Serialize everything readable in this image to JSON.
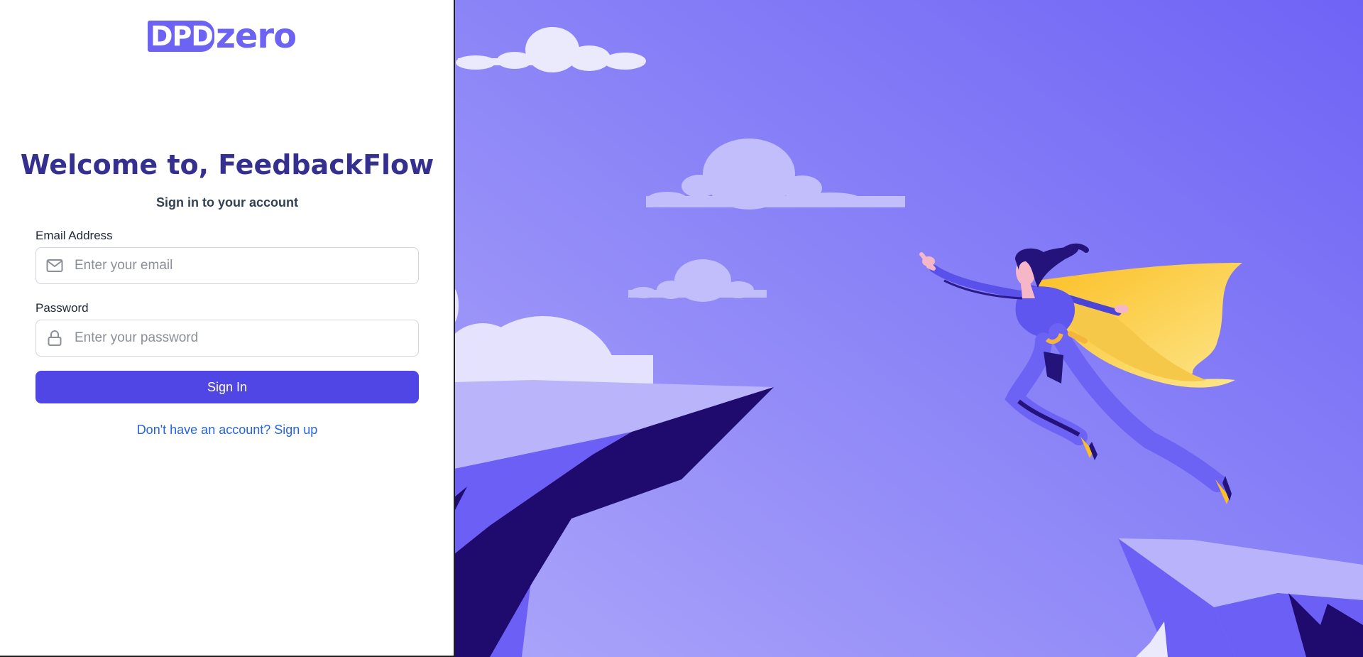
{
  "brand": {
    "logo_box": "DPD",
    "logo_rest": "zero"
  },
  "login": {
    "title": "Welcome to, FeedbackFlow",
    "subtitle": "Sign in to your account",
    "email_label": "Email Address",
    "email_placeholder": "Enter your email",
    "email_value": "",
    "password_label": "Password",
    "password_placeholder": "Enter your password",
    "password_value": "",
    "signin_label": "Sign In",
    "signup_link": "Don't have an account? Sign up"
  },
  "icons": {
    "email": "envelope-icon",
    "password": "lock-icon"
  },
  "colors": {
    "primary": "#5046e5",
    "title": "#35308f",
    "link": "#2563eb",
    "brand": "#6c63f5",
    "sky_top": "#7166f5",
    "sky_bottom": "#aaa4f9"
  }
}
